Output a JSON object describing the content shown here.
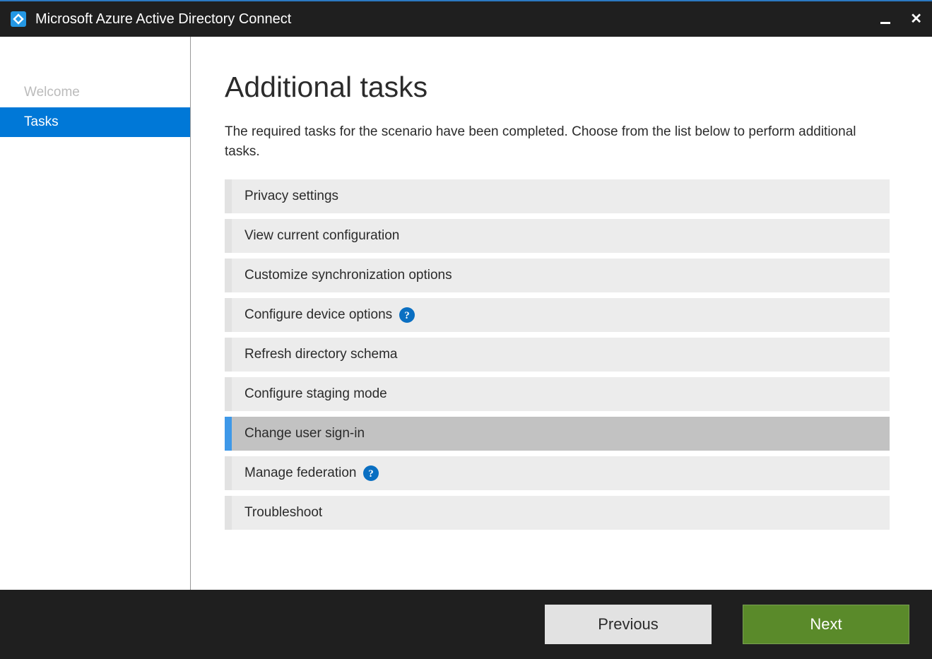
{
  "titlebar": {
    "title": "Microsoft Azure Active Directory Connect"
  },
  "sidebar": {
    "items": [
      {
        "label": "Welcome",
        "state": "disabled"
      },
      {
        "label": "Tasks",
        "state": "active"
      }
    ]
  },
  "content": {
    "title": "Additional tasks",
    "description": "The required tasks for the scenario have been completed. Choose from the list below to perform additional tasks.",
    "tasks": [
      {
        "label": "Privacy settings",
        "help": false,
        "selected": false
      },
      {
        "label": "View current configuration",
        "help": false,
        "selected": false
      },
      {
        "label": "Customize synchronization options",
        "help": false,
        "selected": false
      },
      {
        "label": "Configure device options",
        "help": true,
        "selected": false
      },
      {
        "label": "Refresh directory schema",
        "help": false,
        "selected": false
      },
      {
        "label": "Configure staging mode",
        "help": false,
        "selected": false
      },
      {
        "label": "Change user sign-in",
        "help": false,
        "selected": true
      },
      {
        "label": "Manage federation",
        "help": true,
        "selected": false
      },
      {
        "label": "Troubleshoot",
        "help": false,
        "selected": false
      }
    ]
  },
  "footer": {
    "previous_label": "Previous",
    "next_label": "Next"
  }
}
